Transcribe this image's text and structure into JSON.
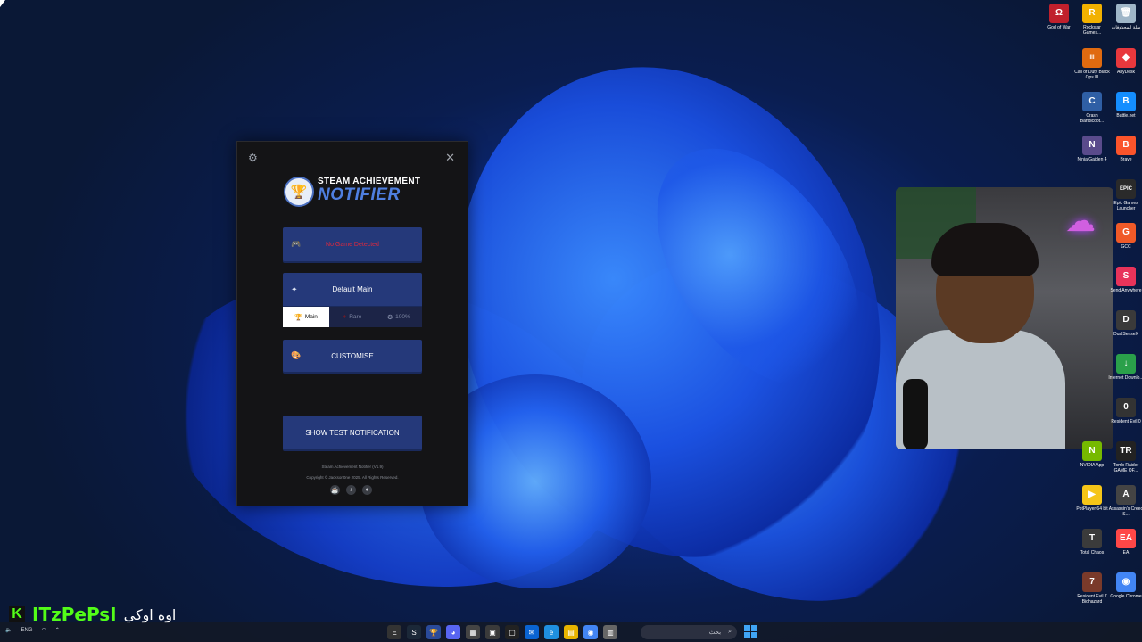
{
  "app": {
    "logo_top": "STEAM ACHIEVEMENT",
    "logo_bottom": "NOTIFIER",
    "game_status": "No Game Detected",
    "theme_button": "Default Main",
    "tabs": [
      {
        "label": "Main",
        "active": true
      },
      {
        "label": "Rare",
        "active": false
      },
      {
        "label": "100%",
        "active": false
      }
    ],
    "customise_button": "CUSTOMISE",
    "test_button": "SHOW TEST NOTIFICATION",
    "version": "Steam Achievement Notifier (V1.9)",
    "copyright": "Copyright © Jackson0ne 2025. All Rights Reserved."
  },
  "desktop_icons": [
    {
      "label": "God of War",
      "color": "#c0202c",
      "glyph": "Ω"
    },
    {
      "label": "Rockstar Games...",
      "color": "#f2b100",
      "glyph": "R"
    },
    {
      "label": "سلة المحذوفات",
      "color": "#9fb6c8",
      "glyph": "🗑"
    },
    {
      "label": "Call of Duty Black Ops III",
      "color": "#e06a10",
      "glyph": "III"
    },
    {
      "label": "AnyDesk",
      "color": "#e8383d",
      "glyph": "◆"
    },
    {
      "label": "Crash Bandicoot...",
      "color": "#2f5fa5",
      "glyph": "C"
    },
    {
      "label": "Battle.net",
      "color": "#148eff",
      "glyph": "B"
    },
    {
      "label": "Ninja Gaiden 4",
      "color": "#5a4b8c",
      "glyph": "N"
    },
    {
      "label": "Brave",
      "color": "#fb542b",
      "glyph": "B"
    },
    {
      "label": "Epic Games Launcher",
      "color": "#2a2a2a",
      "glyph": "EPIC"
    },
    {
      "label": "GCC",
      "color": "#f05a28",
      "glyph": "G"
    },
    {
      "label": "Send Anywhere",
      "color": "#e8335a",
      "glyph": "S"
    },
    {
      "label": "DualSenseX",
      "color": "#3a3a3a",
      "glyph": "D"
    },
    {
      "label": "Internet Downlo...",
      "color": "#2aa04a",
      "glyph": "↓"
    },
    {
      "label": "Resident Evil 0",
      "color": "#333",
      "glyph": "0"
    },
    {
      "label": "NVIDIA App",
      "color": "#76b900",
      "glyph": "N"
    },
    {
      "label": "Tomb Raider GAME OF...",
      "color": "#222",
      "glyph": "TR"
    },
    {
      "label": "PotPlayer 64 bit",
      "color": "#f5c518",
      "glyph": "▶"
    },
    {
      "label": "Assassin's Creed S...",
      "color": "#444",
      "glyph": "A"
    },
    {
      "label": "Total Chaos",
      "color": "#3b3b3b",
      "glyph": "T"
    },
    {
      "label": "EA",
      "color": "#ff4747",
      "glyph": "EA"
    },
    {
      "label": "Resident Evil 7 Biohazard",
      "color": "#7a3a2a",
      "glyph": "7"
    },
    {
      "label": "Google Chrome",
      "color": "#4285f4",
      "glyph": "◉"
    }
  ],
  "overlay": {
    "platform_logo": "K",
    "username": "ITzPePsI",
    "caption": "اوه اوكي"
  },
  "taskbar": {
    "language": "ENG",
    "search_text": "بحث",
    "apps": [
      "EPIC",
      "Steam",
      "Steam Achievement Notifier",
      "Discord",
      "Notes",
      "Store",
      "Epic Games",
      "Outlook",
      "Edge",
      "Explorer",
      "Chrome",
      "Files"
    ]
  }
}
